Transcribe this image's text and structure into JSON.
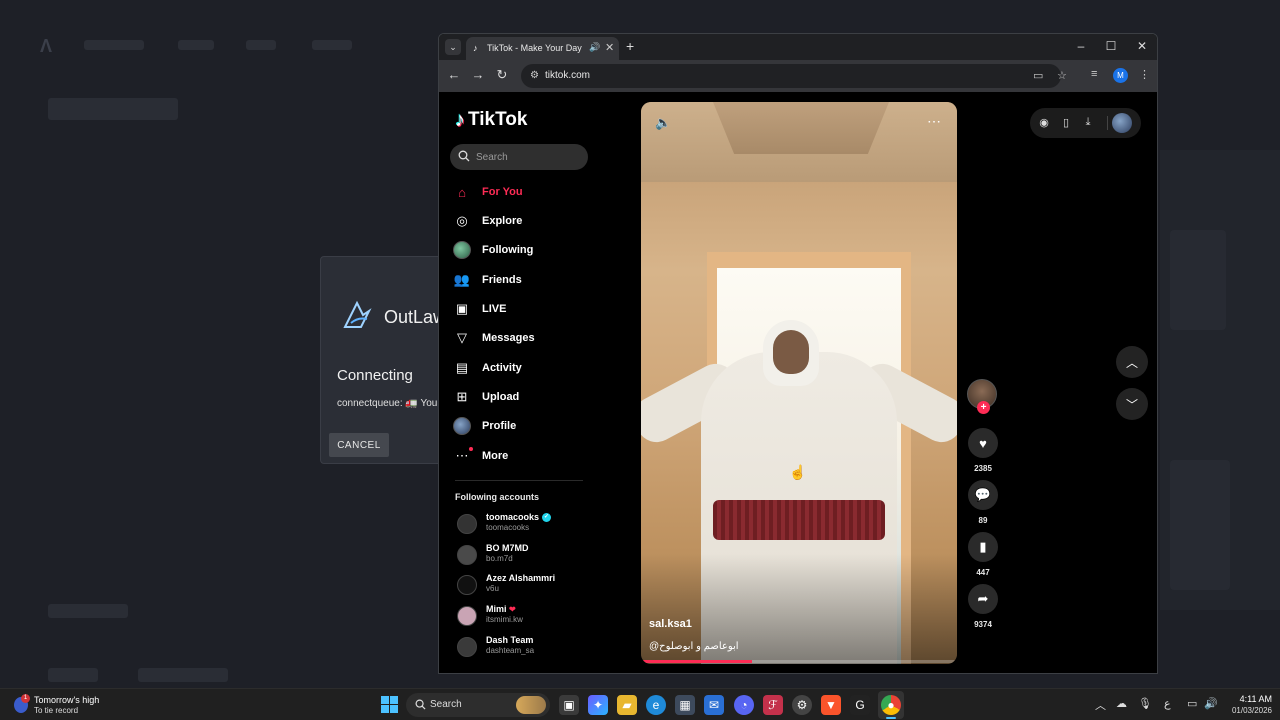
{
  "dialog": {
    "brand": "OutLaw",
    "status": "Connecting",
    "queue_text": "connectqueue: 🚛 You",
    "cancel_label": "CANCEL"
  },
  "browser": {
    "tab_title": "TikTok - Make Your Day",
    "url": "tiktok.com",
    "profile_initial": "M"
  },
  "tiktok": {
    "logo_text": "TikTok",
    "search_placeholder": "Search",
    "menu": [
      {
        "label": "For You",
        "icon": "home-icon",
        "active": true
      },
      {
        "label": "Explore",
        "icon": "compass-icon"
      },
      {
        "label": "Following",
        "icon": "following-avatar"
      },
      {
        "label": "Friends",
        "icon": "friends-icon"
      },
      {
        "label": "LIVE",
        "icon": "live-tv-icon"
      },
      {
        "label": "Messages",
        "icon": "messages-icon"
      },
      {
        "label": "Activity",
        "icon": "activity-icon"
      },
      {
        "label": "Upload",
        "icon": "upload-icon"
      },
      {
        "label": "Profile",
        "icon": "profile-avatar"
      },
      {
        "label": "More",
        "icon": "more-icon"
      }
    ],
    "following_title": "Following accounts",
    "accounts": [
      {
        "name": "toomacooks",
        "handle": "toomacooks",
        "verified": true
      },
      {
        "name": "BO M7MD",
        "handle": "bo.m7d"
      },
      {
        "name": "Azez Alshammri",
        "handle": "v6u"
      },
      {
        "name": "Mimi",
        "handle": "itsmimi.kw"
      },
      {
        "name": "Dash Team",
        "handle": "dashteam_sa"
      }
    ],
    "video": {
      "author": "sal.ksa1",
      "caption": "ابوعاصم و ابوصلوح@",
      "progress": 0.35
    },
    "actions": {
      "likes": "2385",
      "comments": "89",
      "saves": "447",
      "shares": "9374"
    }
  },
  "taskbar": {
    "weather_line1": "Tomorrow's high",
    "weather_line2": "To tie record",
    "weather_badge": "1",
    "search_label": "Search",
    "time": "4:11 AM",
    "date": "01/03/2026"
  },
  "colors": {
    "tiktok_red": "#fe2c55",
    "tiktok_cyan": "#25f4ee",
    "windows_accent": "#4cc2ff"
  }
}
